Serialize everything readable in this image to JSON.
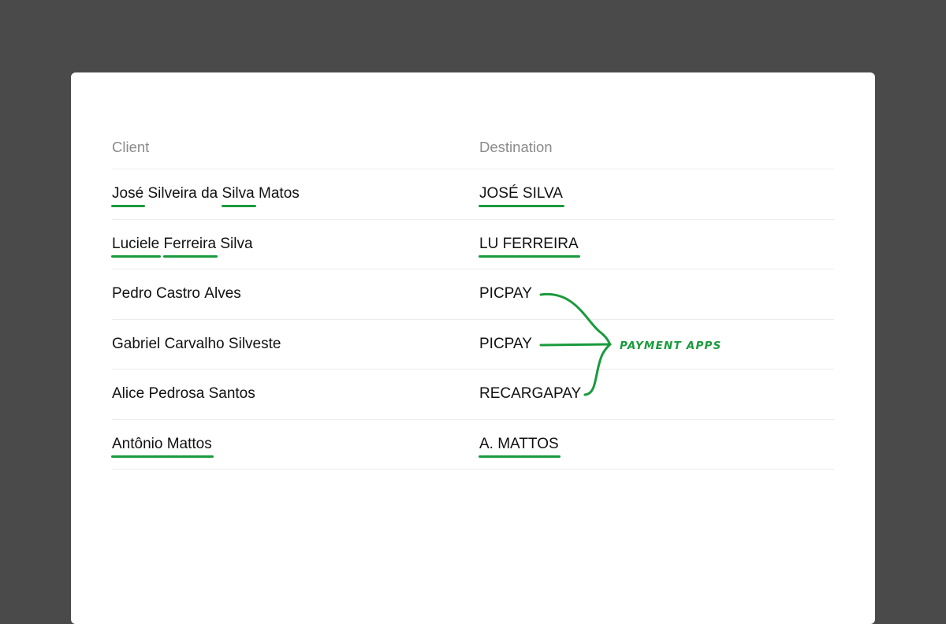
{
  "headers": {
    "client": "Client",
    "destination": "Destination"
  },
  "rows": [
    {
      "client": [
        {
          "text": "José",
          "underline": true
        },
        {
          "text": "Silveira",
          "underline": false
        },
        {
          "text": "da",
          "underline": false
        },
        {
          "text": "Silva",
          "underline": true
        },
        {
          "text": "Matos",
          "underline": false
        }
      ],
      "destination": "JOSÉ SILVA",
      "destination_underlined": true
    },
    {
      "client": [
        {
          "text": "Luciele",
          "underline": true
        },
        {
          "text": "Ferreira",
          "underline": true
        },
        {
          "text": "Silva",
          "underline": false
        }
      ],
      "destination": "LU FERREIRA",
      "destination_underlined": true
    },
    {
      "client": [
        {
          "text": "Pedro",
          "underline": false
        },
        {
          "text": "Castro",
          "underline": false
        },
        {
          "text": "Alves",
          "underline": false
        }
      ],
      "destination": "PICPAY",
      "destination_underlined": false
    },
    {
      "client": [
        {
          "text": "Gabriel",
          "underline": false
        },
        {
          "text": "Carvalho",
          "underline": false
        },
        {
          "text": "Silveste",
          "underline": false
        }
      ],
      "destination": "PICPAY",
      "destination_underlined": false
    },
    {
      "client": [
        {
          "text": "Alice",
          "underline": false
        },
        {
          "text": "Pedrosa",
          "underline": false
        },
        {
          "text": "Santos",
          "underline": false
        }
      ],
      "destination": "RECARGAPAY",
      "destination_underlined": false
    },
    {
      "client": [
        {
          "text": "Antônio Mattos",
          "underline": true
        }
      ],
      "destination": "A. MATTOS",
      "destination_underlined": true
    }
  ],
  "annotation": {
    "label": "PAYMENT APPS",
    "color": "#1a9a3c"
  }
}
